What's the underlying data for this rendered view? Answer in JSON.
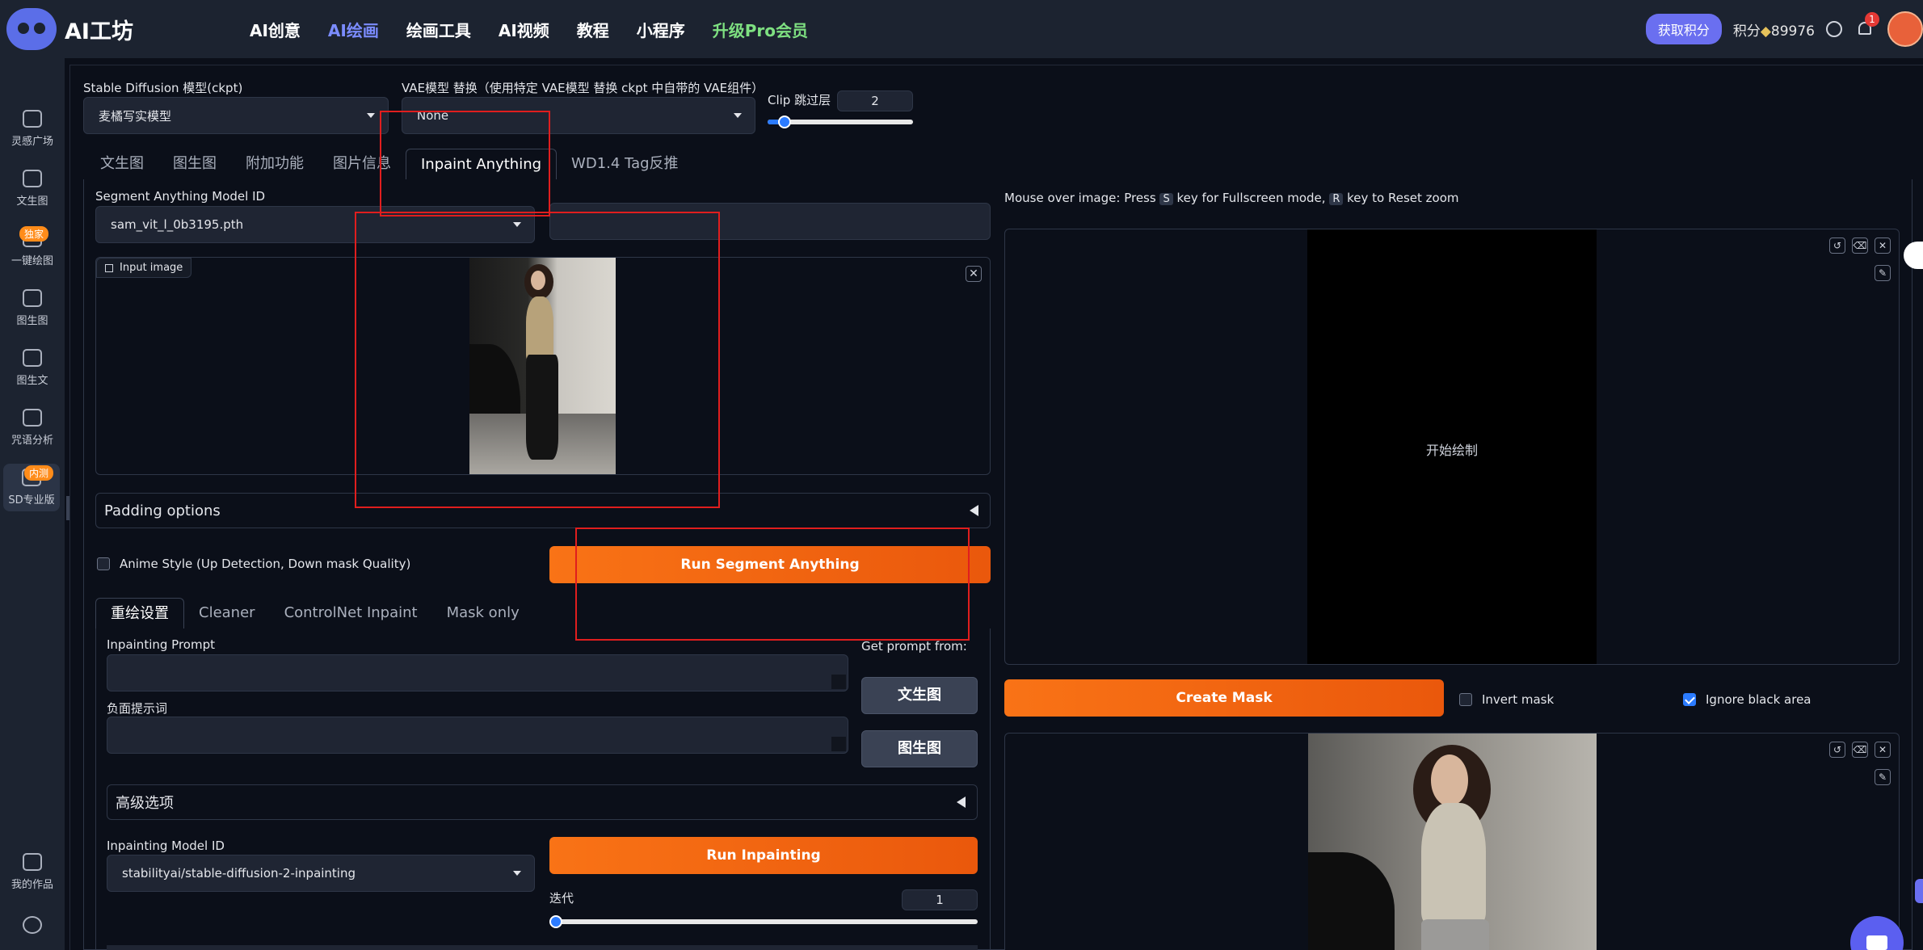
{
  "brand": {
    "name": "AI工坊"
  },
  "nav": {
    "items": [
      {
        "label": "AI创意",
        "active": false
      },
      {
        "label": "AI绘画",
        "active": true
      },
      {
        "label": "绘画工具",
        "active": false
      },
      {
        "label": "AI视频",
        "active": false
      },
      {
        "label": "教程",
        "active": false
      },
      {
        "label": "小程序",
        "active": false
      },
      {
        "label": "升级Pro会员",
        "active": false
      }
    ],
    "get_points": "获取积分",
    "points_label": "积分",
    "points_value": "89976",
    "notifications": "1"
  },
  "sidebar": {
    "items": [
      {
        "label": "灵感广场"
      },
      {
        "label": "文生图"
      },
      {
        "label": "一键绘图",
        "tag": "独家"
      },
      {
        "label": "图生图"
      },
      {
        "label": "图生文"
      },
      {
        "label": "咒语分析"
      },
      {
        "label": "SD专业版",
        "tag": "内测"
      }
    ],
    "bottom": {
      "label": "我的作品"
    }
  },
  "settings": {
    "ckpt_label": "Stable Diffusion 模型(ckpt)",
    "ckpt_value": "麦橘写实模型",
    "vae_label": "VAE模型 替换（使用特定 VAE模型 替换 ckpt 中自带的 VAE组件）",
    "vae_value": "None",
    "clip_label": "Clip 跳过层",
    "clip_value": "2",
    "clip_fraction": 0.08
  },
  "main_tabs": [
    {
      "label": "文生图"
    },
    {
      "label": "图生图"
    },
    {
      "label": "附加功能"
    },
    {
      "label": "图片信息"
    },
    {
      "label": "Inpaint Anything",
      "active": true
    },
    {
      "label": "WD1.4 Tag反推"
    }
  ],
  "inpaint": {
    "sam_label": "Segment Anything Model ID",
    "sam_value": "sam_vit_l_0b3195.pth",
    "input_image_label": "Input image",
    "padding_label": "Padding options",
    "anime_label": "Anime Style (Up Detection, Down mask Quality)",
    "run_sam": "Run Segment Anything",
    "sub_tabs": [
      {
        "label": "重绘设置",
        "active": true
      },
      {
        "label": "Cleaner"
      },
      {
        "label": "ControlNet Inpaint"
      },
      {
        "label": "Mask only"
      }
    ],
    "prompt_label": "Inpainting Prompt",
    "negative_label": "负面提示词",
    "get_prompt_label": "Get prompt from:",
    "btn_txt2img": "文生图",
    "btn_img2img": "图生图",
    "advanced_label": "高级选项",
    "model_label": "Inpainting Model ID",
    "model_value": "stabilityai/stable-diffusion-2-inpainting",
    "run_inpaint": "Run Inpainting",
    "iter_label": "迭代",
    "iter_value": "1",
    "iter_fraction": 0.0
  },
  "right": {
    "hint_prefix": "Mouse over image: Press",
    "hint_key1": "S",
    "hint_mid": "key for Fullscreen mode,",
    "hint_key2": "R",
    "hint_suffix": "key to Reset zoom",
    "canvas_text": "开始绘制",
    "create_mask": "Create Mask",
    "invert_mask": "Invert mask",
    "ignore_black": "Ignore black area"
  },
  "colors": {
    "accent": "#f97316",
    "nav_active": "#7b8cff",
    "pro": "#7ee081",
    "highlight": "#e01e1e"
  }
}
